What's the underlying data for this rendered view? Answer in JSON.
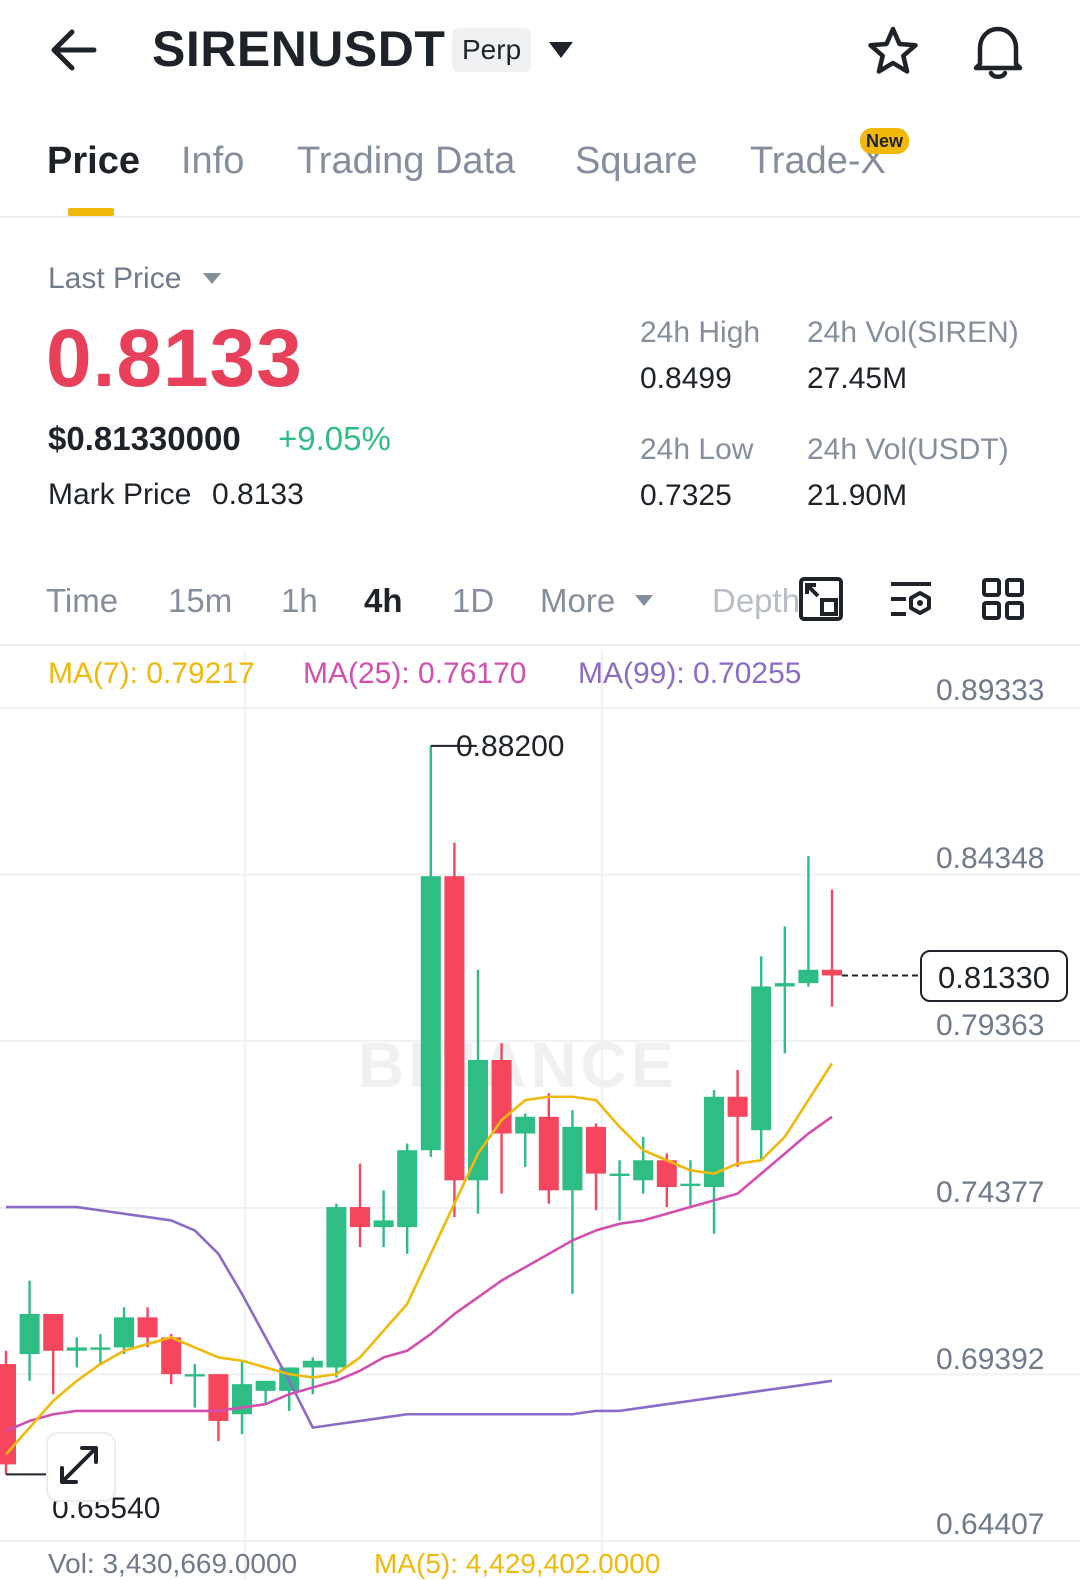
{
  "header": {
    "symbol": "SIRENUSDT",
    "badge": "Perp",
    "icons": [
      "arrow-left-icon",
      "caret-down-icon",
      "star-icon",
      "bell-icon"
    ]
  },
  "tabs": [
    {
      "label": "Price",
      "active": true
    },
    {
      "label": "Info"
    },
    {
      "label": "Trading Data"
    },
    {
      "label": "Square"
    },
    {
      "label": "Trade-X",
      "badge": "New"
    }
  ],
  "price": {
    "last_price_label": "Last Price",
    "last_price": "0.8133",
    "usd_price": "$0.81330000",
    "change_pct": "+9.05%",
    "mark_label": "Mark Price",
    "mark_value": "0.8133"
  },
  "stats": {
    "high_label": "24h High",
    "high_value": "0.8499",
    "vol_base_label": "24h Vol(SIREN)",
    "vol_base_value": "27.45M",
    "low_label": "24h Low",
    "low_value": "0.7325",
    "vol_quote_label": "24h Vol(USDT)",
    "vol_quote_value": "21.90M"
  },
  "timeframes": {
    "items": [
      "Time",
      "15m",
      "1h",
      "4h",
      "1D",
      "More",
      "Depth"
    ],
    "active": "4h",
    "tool_icons": [
      "fullscreen-chart-icon",
      "indicator-settings-icon",
      "grid-layout-icon"
    ]
  },
  "ma": {
    "ma7": "MA(7): 0.79217",
    "ma25": "MA(25): 0.76170",
    "ma99": "MA(99): 0.70255"
  },
  "volume": {
    "vol": "Vol: 3,430,669.0000",
    "ma5": "MA(5): 4,429,402.0000"
  },
  "colors": {
    "up": "#2ebd85",
    "down": "#f6465d",
    "price_red": "#e8405a",
    "ma7": "#f0b90b",
    "ma25": "#d24fb0",
    "ma99": "#8c6bc8",
    "accent": "#f0b90b"
  },
  "chart_data": {
    "type": "candlestick",
    "price_axis_ticks": [
      "0.89333",
      "0.84348",
      "0.81330",
      "0.79363",
      "0.74377",
      "0.69392",
      "0.64407"
    ],
    "last_price_label": "0.81330",
    "annotations": {
      "high": "0.88200",
      "low": "0.65540"
    },
    "watermark": "BINANCE",
    "candles": [
      {
        "o": 0.697,
        "h": 0.701,
        "l": 0.664,
        "c": 0.667
      },
      {
        "o": 0.7,
        "h": 0.722,
        "l": 0.692,
        "c": 0.712
      },
      {
        "o": 0.712,
        "h": 0.712,
        "l": 0.688,
        "c": 0.701
      },
      {
        "o": 0.701,
        "h": 0.705,
        "l": 0.696,
        "c": 0.702
      },
      {
        "o": 0.702,
        "h": 0.706,
        "l": 0.697,
        "c": 0.702
      },
      {
        "o": 0.702,
        "h": 0.714,
        "l": 0.7,
        "c": 0.711
      },
      {
        "o": 0.711,
        "h": 0.714,
        "l": 0.702,
        "c": 0.705
      },
      {
        "o": 0.705,
        "h": 0.706,
        "l": 0.691,
        "c": 0.694
      },
      {
        "o": 0.694,
        "h": 0.697,
        "l": 0.684,
        "c": 0.694
      },
      {
        "o": 0.694,
        "h": 0.694,
        "l": 0.674,
        "c": 0.68
      },
      {
        "o": 0.682,
        "h": 0.698,
        "l": 0.676,
        "c": 0.691
      },
      {
        "o": 0.689,
        "h": 0.692,
        "l": 0.685,
        "c": 0.692
      },
      {
        "o": 0.689,
        "h": 0.696,
        "l": 0.683,
        "c": 0.696
      },
      {
        "o": 0.696,
        "h": 0.699,
        "l": 0.688,
        "c": 0.698
      },
      {
        "o": 0.696,
        "h": 0.745,
        "l": 0.693,
        "c": 0.744
      },
      {
        "o": 0.744,
        "h": 0.757,
        "l": 0.732,
        "c": 0.738
      },
      {
        "o": 0.738,
        "h": 0.749,
        "l": 0.732,
        "c": 0.74
      },
      {
        "o": 0.738,
        "h": 0.763,
        "l": 0.73,
        "c": 0.761
      },
      {
        "o": 0.761,
        "h": 0.882,
        "l": 0.759,
        "c": 0.843
      },
      {
        "o": 0.843,
        "h": 0.853,
        "l": 0.741,
        "c": 0.752
      },
      {
        "o": 0.752,
        "h": 0.815,
        "l": 0.742,
        "c": 0.788
      },
      {
        "o": 0.788,
        "h": 0.793,
        "l": 0.748,
        "c": 0.766
      },
      {
        "o": 0.766,
        "h": 0.772,
        "l": 0.756,
        "c": 0.771
      },
      {
        "o": 0.771,
        "h": 0.778,
        "l": 0.745,
        "c": 0.749
      },
      {
        "o": 0.749,
        "h": 0.773,
        "l": 0.718,
        "c": 0.768
      },
      {
        "o": 0.768,
        "h": 0.769,
        "l": 0.743,
        "c": 0.754
      },
      {
        "o": 0.754,
        "h": 0.758,
        "l": 0.74,
        "c": 0.754
      },
      {
        "o": 0.752,
        "h": 0.765,
        "l": 0.748,
        "c": 0.758
      },
      {
        "o": 0.758,
        "h": 0.76,
        "l": 0.744,
        "c": 0.75
      },
      {
        "o": 0.751,
        "h": 0.758,
        "l": 0.744,
        "c": 0.751
      },
      {
        "o": 0.75,
        "h": 0.779,
        "l": 0.736,
        "c": 0.777
      },
      {
        "o": 0.777,
        "h": 0.785,
        "l": 0.756,
        "c": 0.771
      },
      {
        "o": 0.767,
        "h": 0.819,
        "l": 0.758,
        "c": 0.81
      },
      {
        "o": 0.81,
        "h": 0.828,
        "l": 0.79,
        "c": 0.811
      },
      {
        "o": 0.811,
        "h": 0.849,
        "l": 0.81,
        "c": 0.815
      },
      {
        "o": 0.815,
        "h": 0.839,
        "l": 0.804,
        "c": 0.8133
      }
    ],
    "ma7": [
      0.67,
      0.678,
      0.686,
      0.692,
      0.697,
      0.701,
      0.703,
      0.705,
      0.702,
      0.699,
      0.698,
      0.696,
      0.694,
      0.693,
      0.694,
      0.699,
      0.707,
      0.715,
      0.73,
      0.745,
      0.76,
      0.77,
      0.776,
      0.777,
      0.777,
      0.776,
      0.768,
      0.761,
      0.758,
      0.755,
      0.754,
      0.757,
      0.758,
      0.765,
      0.776,
      0.787
    ],
    "ma25": [
      0.677,
      0.68,
      0.682,
      0.683,
      0.683,
      0.683,
      0.683,
      0.683,
      0.683,
      0.683,
      0.684,
      0.685,
      0.688,
      0.69,
      0.692,
      0.695,
      0.699,
      0.701,
      0.706,
      0.712,
      0.717,
      0.722,
      0.726,
      0.73,
      0.734,
      0.737,
      0.739,
      0.74,
      0.742,
      0.744,
      0.746,
      0.748,
      0.754,
      0.76,
      0.766,
      0.771
    ],
    "ma99": [
      0.744,
      0.744,
      0.744,
      0.744,
      0.743,
      0.742,
      0.741,
      0.74,
      0.737,
      0.73,
      0.718,
      0.705,
      0.692,
      0.678,
      0.679,
      0.68,
      0.681,
      0.682,
      0.682,
      0.682,
      0.682,
      0.682,
      0.682,
      0.682,
      0.682,
      0.683,
      0.683,
      0.684,
      0.685,
      0.686,
      0.687,
      0.688,
      0.689,
      0.69,
      0.691,
      0.692
    ]
  }
}
